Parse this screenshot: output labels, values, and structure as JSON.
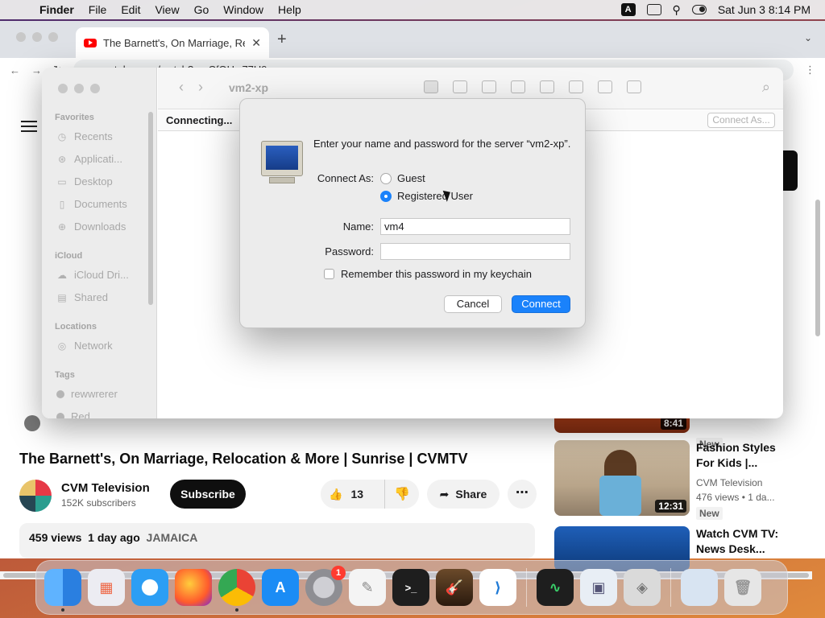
{
  "menubar": {
    "app": "Finder",
    "menus": [
      "File",
      "Edit",
      "View",
      "Go",
      "Window",
      "Help"
    ],
    "input_indicator": "A",
    "clock": "Sat Jun 3  8:14 PM"
  },
  "browser": {
    "tab_title": "The Barnett's, On Marriage, Re",
    "url": "youtube.com/watch?v=rCfOHw77H9o"
  },
  "youtube": {
    "video_title": "The Barnett's, On Marriage, Relocation & More | Sunrise | CVMTV",
    "channel_name": "CVM Television",
    "subscribers": "152K subscribers",
    "subscribe_label": "Subscribe",
    "likes": "13",
    "share_label": "Share",
    "more_label": "⋯",
    "views": "459 views",
    "date": "1 day ago",
    "tag": "JAMAICA",
    "recommendations": [
      {
        "duration": "8:41",
        "badge": "New"
      },
      {
        "title": "Fashion Styles For Kids |...",
        "channel": "CVM Television",
        "meta": "476 views • 1 da...",
        "duration": "12:31",
        "badge": "New"
      },
      {
        "title": "Watch CVM TV: News Desk..."
      }
    ]
  },
  "finder": {
    "title": "vm2-xp",
    "status": "Connecting...",
    "connect_as_label": "Connect As...",
    "sidebar": {
      "favorites_header": "Favorites",
      "favorites": [
        "Recents",
        "Applicati...",
        "Desktop",
        "Documents",
        "Downloads"
      ],
      "icloud_header": "iCloud",
      "icloud": [
        "iCloud Dri...",
        "Shared"
      ],
      "locations_header": "Locations",
      "locations": [
        "Network"
      ],
      "tags_header": "Tags",
      "tags": [
        "rewwrerer",
        "Red"
      ]
    }
  },
  "dialog": {
    "prompt": "Enter your name and password for the server “vm2-xp”.",
    "connect_as_label": "Connect As:",
    "guest_label": "Guest",
    "registered_label": "Registered User",
    "selected_option": "Registered User",
    "name_label": "Name:",
    "name_value": "vm4",
    "password_label": "Password:",
    "password_value": "",
    "remember_label": "Remember this password in my keychain",
    "remember_checked": false,
    "cancel_label": "Cancel",
    "connect_label": "Connect"
  },
  "dock": {
    "items": [
      {
        "name": "finder",
        "color": "#3a8ef0"
      },
      {
        "name": "launchpad",
        "color": "#e0e0e8"
      },
      {
        "name": "safari",
        "color": "#2c9ef4"
      },
      {
        "name": "firefox",
        "color": "#ff7139"
      },
      {
        "name": "chrome",
        "color": "#f4f4f4"
      },
      {
        "name": "app-store",
        "color": "#1b8cf5"
      },
      {
        "name": "system-preferences",
        "color": "#8e8e93",
        "badge": "1"
      },
      {
        "name": "textedit",
        "color": "#f4f4f4"
      },
      {
        "name": "terminal",
        "color": "#1e1e1e"
      },
      {
        "name": "garageband",
        "color": "#3a2a1a"
      },
      {
        "name": "vscode",
        "color": "#ffffff"
      },
      {
        "name": "activity-monitor",
        "color": "#1e1e1e"
      },
      {
        "name": "preview",
        "color": "#e8eef5"
      },
      {
        "name": "migration-assistant",
        "color": "#dadada"
      },
      {
        "name": "downloads-stack",
        "color": "#d8e4f2"
      },
      {
        "name": "trash",
        "color": "#e6e6e6"
      }
    ]
  }
}
